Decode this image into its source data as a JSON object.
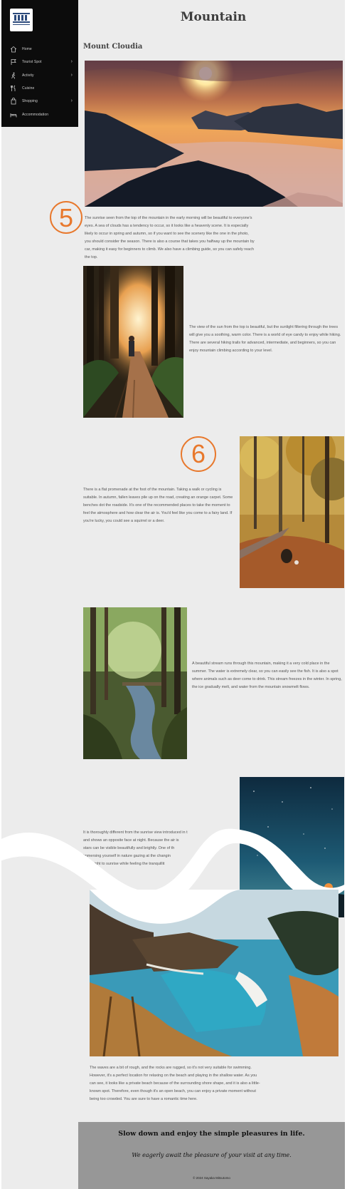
{
  "page": {
    "title": "Mountain",
    "section_title": "Mount Cloudia"
  },
  "sidebar": {
    "logo": "mountain-logo-icon",
    "items": [
      {
        "label": "Home",
        "icon": "home-icon",
        "has_submenu": false
      },
      {
        "label": "Tourist Spot",
        "icon": "flag-icon",
        "has_submenu": true
      },
      {
        "label": "Activity",
        "icon": "hiking-icon",
        "has_submenu": true
      },
      {
        "label": "Cuisine",
        "icon": "cutlery-icon",
        "has_submenu": false
      },
      {
        "label": "Shopping",
        "icon": "shopping-bag-icon",
        "has_submenu": true
      },
      {
        "label": "Accommodation",
        "icon": "bed-icon",
        "has_submenu": false
      }
    ],
    "chevron": "›"
  },
  "steps": {
    "five": "5",
    "six": "6"
  },
  "paragraphs": {
    "sunrise": "The sunrise seen from the top of the mountain in the early morning will be beautiful to everyone's eyes. A sea of clouds has a tendency to occur, so it looks like a heavenly scene. It is especially likely to occur in spring and autumn, so if you want to see the scenery like the one in the photo, you should consider the season. There is also a course that takes you halfway up the mountain by car, making it easy for beginners to climb. We also have a climbing guide, so you can safely reach the top.",
    "forest": "The view of the sun from the top is beautiful, but the sunlight filtering through the trees will give you a soothing, warm color. There is a world of eye candy to enjoy while hiking. There are several hiking trails for advanced, intermediate, and beginners, so you can enjoy mountain climbing according to your level.",
    "promenade": "There is a flat promenade at the foot of the mountain. Taking a walk or cycling is suitable. In autumn, fallen leaves pile up on the road, creating an orange carpet. Some benches dot the roadside. It's one of the recommended places to take the moment to feel the atmosphere and how clear the air is. You'd feel like you come to a fairy land. If you're lucky, you could see a squirrel or a deer.",
    "stream": "A beautiful stream runs through this mountain, making it a very cold place in the summer. The water is extremely clear, so you can easily see the fish. It is also a spot where animals such as deer come to drink. This stream freezes in the winter. In spring, the ice gradually melt, and water from the mountain snowmelt flows.",
    "night_lines": [
      "It is thoroughly different from the sunrise view introduced in t",
      "and shows an opposite face at night. Because the air is",
      "stars can be visible beautifully and brightly. One of th",
      "immersing yourself in nature gazing at the changin",
      "from night to sunrise while feeling the tranquillit"
    ],
    "beach": "The waves are a bit of rough, and the rocks are rugged, so it's not very suitable for swimming. However, it's a perfect location for relaxing on the beach and playing in the shallow water. As you can see, it looks like a private beach because of the surrounding shore shape, and it is also a little-known spot. Therefore, even though it's an open beach, you can enjoy a private moment without being too crowded. You are sure to have a romantic time here."
  },
  "footer": {
    "headline": "Slow down and enjoy the simple pleasures in life.",
    "tagline": "We eagerly await the pleasure of your visit at any time.",
    "copyright": "© 2024 Sayaka Mitsutomo"
  },
  "colors": {
    "accent_orange": "#e8782c",
    "sidebar_bg": "#0c0c0c",
    "page_bg": "#ececec",
    "footer_bg": "#979797"
  }
}
